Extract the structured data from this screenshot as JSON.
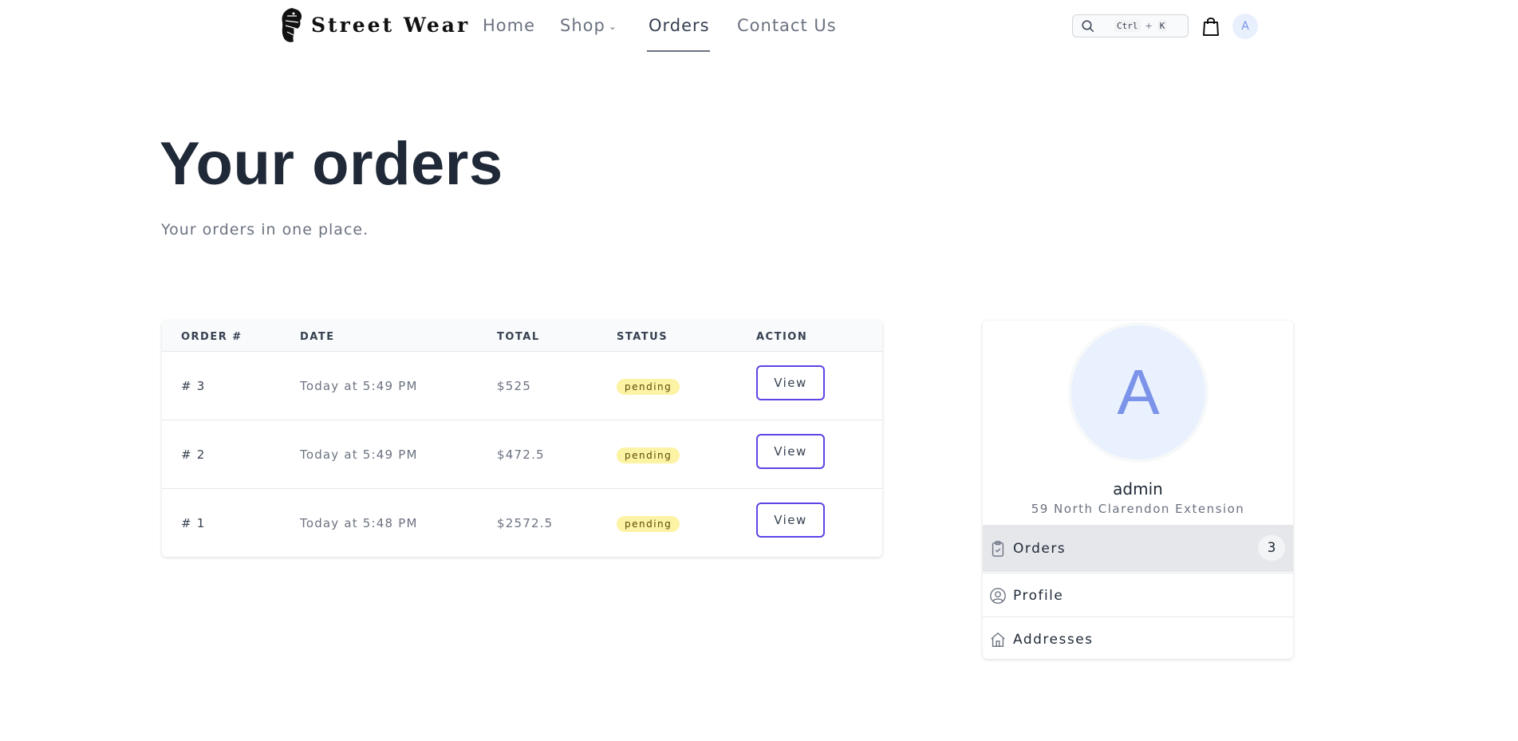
{
  "header": {
    "logo_text": "Street Wear",
    "nav": [
      {
        "label": "Home"
      },
      {
        "label": "Shop"
      },
      {
        "label": "Orders"
      },
      {
        "label": "Contact Us"
      }
    ],
    "search": {
      "shortcut_key1": "Ctrl",
      "shortcut_plus": "+",
      "shortcut_key2": "K"
    },
    "avatar_letter": "A"
  },
  "hero": {
    "title": "Your orders",
    "subtitle": "Your orders in one place."
  },
  "orders_table": {
    "columns": [
      "ORDER #",
      "DATE",
      "TOTAL",
      "STATUS",
      "ACTION"
    ],
    "rows": [
      {
        "order": "# 3",
        "date": "Today at 5:49 PM",
        "total": "$525",
        "status": "pending",
        "action": "View"
      },
      {
        "order": "# 2",
        "date": "Today at 5:49 PM",
        "total": "$472.5",
        "status": "pending",
        "action": "View"
      },
      {
        "order": "# 1",
        "date": "Today at 5:48 PM",
        "total": "$2572.5",
        "status": "pending",
        "action": "View"
      }
    ]
  },
  "profile": {
    "avatar_letter": "A",
    "name": "admin",
    "address": "59 North Clarendon Extension",
    "menu": [
      {
        "label": "Orders",
        "count": "3",
        "icon": "clipboard-icon"
      },
      {
        "label": "Profile",
        "icon": "user-circle-icon"
      },
      {
        "label": "Addresses",
        "icon": "home-icon"
      }
    ]
  },
  "colors": {
    "accent_button_border": "#5b46e5",
    "badge_bg": "#fdf3a4",
    "avatar_bg": "#e9f1fe",
    "avatar_text": "#7b93e8"
  }
}
